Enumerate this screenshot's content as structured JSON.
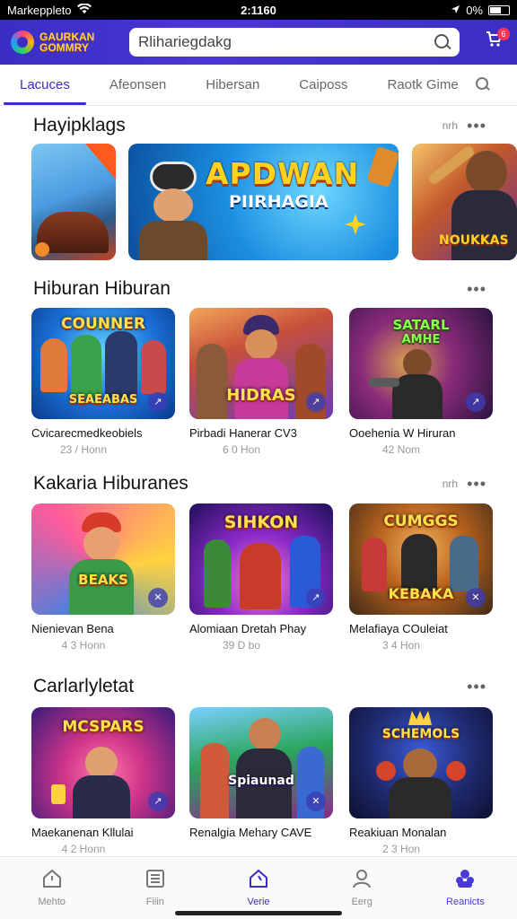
{
  "status_bar": {
    "carrier": "Markeppleto",
    "time": "2:1160",
    "battery": "0%"
  },
  "header": {
    "logo_line1": "GAURKAN",
    "logo_line2": "GOMMRY",
    "search_value": "Rlihariegdakg",
    "cart_badge": "6"
  },
  "tabs": [
    {
      "label": "Lacuces",
      "active": true
    },
    {
      "label": "Afeonsen",
      "active": false
    },
    {
      "label": "Hibersan",
      "active": false
    },
    {
      "label": "Caiposs",
      "active": false
    },
    {
      "label": "Raotk Gime",
      "active": false
    }
  ],
  "sections": [
    {
      "title": "Hayipklags",
      "more": "nrh",
      "banners": [
        {
          "title": "",
          "colors": [
            "#e35a2b",
            "#3a7bd5"
          ]
        },
        {
          "title": "APDWAN",
          "subtitle": "PIIRHAGIA",
          "colors": [
            "#0e8ad8",
            "#44c7ff"
          ]
        },
        {
          "title": "NOUKKAS",
          "colors": [
            "#7a3fc0",
            "#f07a2e"
          ]
        }
      ]
    },
    {
      "title": "Hiburan Hiburan",
      "more": "",
      "cards": [
        {
          "thumb_title": "COUNNER",
          "thumb_sub": "SEAEABAS",
          "name": "Cvicarecmedkeobiels",
          "sub": "23 / Honn",
          "colors": [
            "#1a6fd6",
            "#3ec2ff"
          ]
        },
        {
          "thumb_title": "HIDRAS",
          "thumb_sub": "",
          "name": "Pirbadi Hanerar CV3",
          "sub": "6 0 Hon",
          "colors": [
            "#e0673a",
            "#7e45c8"
          ]
        },
        {
          "thumb_title": "SATARL",
          "thumb_sub": "AMHE",
          "name": "Ooehenia W Hiruran",
          "sub": "42 Nom",
          "colors": [
            "#5b2a96",
            "#d23f9a"
          ]
        }
      ]
    },
    {
      "title": "Kakaria Hiburanes",
      "more": "nrh",
      "cards": [
        {
          "thumb_title": "BEAKS",
          "thumb_sub": "",
          "name": "Nienievan Bena",
          "sub": "4 3 Honn",
          "colors": [
            "#2c86e8",
            "#ff5b9a"
          ]
        },
        {
          "thumb_title": "SIHKON",
          "thumb_sub": "",
          "name": "Alomiaan Dretah Phay",
          "sub": "39 D bo",
          "colors": [
            "#3b1e8c",
            "#c04ad8"
          ]
        },
        {
          "thumb_title": "CUMGGS",
          "thumb_sub": "KEBAKA",
          "name": "Melafiaya COuleiat",
          "sub": "3 4 Hon",
          "colors": [
            "#b8621e",
            "#3d2a18"
          ]
        }
      ]
    },
    {
      "title": "Carlarlyletat",
      "more": "",
      "cards": [
        {
          "thumb_title": "MCSPARS",
          "thumb_sub": "",
          "name": "Maekanenan Kllulai",
          "sub": "4 2 Honn",
          "colors": [
            "#d0358a",
            "#5a2aa8"
          ]
        },
        {
          "thumb_title": "Spiaunad",
          "thumb_sub": "",
          "name": "Renalgia Mehary CAVE",
          "sub": "",
          "colors": [
            "#2aa55c",
            "#e65a9c"
          ]
        },
        {
          "thumb_title": "SCHEMOLS",
          "thumb_sub": "",
          "name": "Reakiuan Monalan",
          "sub": "2 3 Hon",
          "colors": [
            "#1e2a6e",
            "#d4442a"
          ]
        }
      ]
    }
  ],
  "bottom_nav": [
    {
      "label": "Mehto",
      "state": "normal"
    },
    {
      "label": "Fiiin",
      "state": "normal"
    },
    {
      "label": "Verie",
      "state": "active"
    },
    {
      "label": "Eerg",
      "state": "normal"
    },
    {
      "label": "Reanicts",
      "state": "selected"
    }
  ]
}
